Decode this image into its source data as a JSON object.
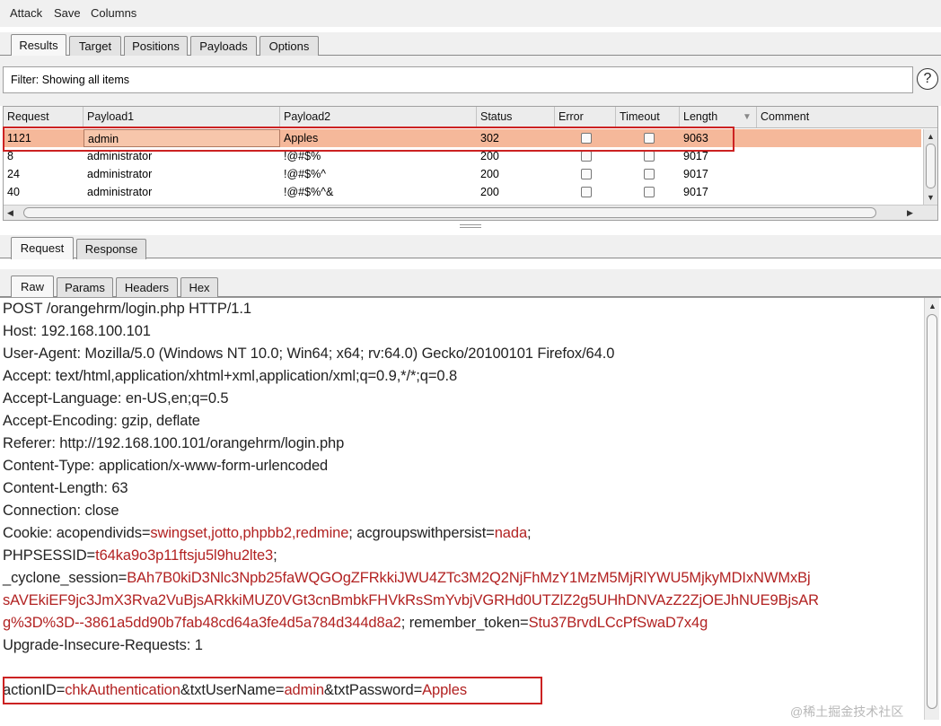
{
  "menu": {
    "attack": "Attack",
    "save": "Save",
    "columns": "Columns"
  },
  "top_tabs": [
    "Results",
    "Target",
    "Positions",
    "Payloads",
    "Options"
  ],
  "filter": {
    "text": "Filter: Showing all items",
    "help": "?"
  },
  "table": {
    "headers": [
      "Request",
      "Payload1",
      "Payload2",
      "Status",
      "Error",
      "Timeout",
      "Length",
      "Comment"
    ],
    "sort_indicator": "▼",
    "rows": [
      {
        "request": "1121",
        "payload1": "admin",
        "payload2": "Apples",
        "status": "302",
        "error": false,
        "timeout": false,
        "length": "9063",
        "comment": ""
      },
      {
        "request": "8",
        "payload1": "administrator",
        "payload2": "!@#$%",
        "status": "200",
        "error": false,
        "timeout": false,
        "length": "9017",
        "comment": ""
      },
      {
        "request": "24",
        "payload1": "administrator",
        "payload2": "!@#$%^",
        "status": "200",
        "error": false,
        "timeout": false,
        "length": "9017",
        "comment": ""
      },
      {
        "request": "40",
        "payload1": "administrator",
        "payload2": "!@#$%^&",
        "status": "200",
        "error": false,
        "timeout": false,
        "length": "9017",
        "comment": ""
      }
    ]
  },
  "reqresp_tabs": [
    "Request",
    "Response"
  ],
  "view_tabs": [
    "Raw",
    "Params",
    "Headers",
    "Hex"
  ],
  "request_lines": {
    "l1": "POST /orangehrm/login.php HTTP/1.1",
    "l2": "Host: 192.168.100.101",
    "l3": "User-Agent: Mozilla/5.0 (Windows NT 10.0; Win64; x64; rv:64.0) Gecko/20100101 Firefox/64.0",
    "l4": "Accept: text/html,application/xhtml+xml,application/xml;q=0.9,*/*;q=0.8",
    "l5": "Accept-Language: en-US,en;q=0.5",
    "l6": "Accept-Encoding: gzip, deflate",
    "l7": "Referer: http://192.168.100.101/orangehrm/login.php",
    "l8": "Content-Type: application/x-www-form-urlencoded",
    "l9": "Content-Length: 63",
    "l10": "Connection: close",
    "cookie_key": "Cookie: acopendivids=",
    "cookie_val1": "swingset,jotto,phpbb2,redmine",
    "cookie_mid": "; acgroupswithpersist=",
    "cookie_val2": "nada",
    "cookie_end": ";",
    "phpsess_key": "PHPSESSID=",
    "phpsess_val": "t64ka9o3p11ftsju5l9hu2lte3",
    "phpsess_end": ";",
    "cyclone_key": "_cyclone_session=",
    "cyclone_val1": "BAh7B0kiD3Nlc3Npb25faWQGOgZFRkkiJWU4ZTc3M2Q2NjFhMzY1MzM5MjRlYWU5MjkyMDIxNWMxBj",
    "cyclone_val2": "sAVEkiEF9jc3JmX3Rva2VuBjsARkkiMUZ0VGt3cnBmbkFHVkRsSmYvbjVGRHd0UTZlZ2g5UHhDNVAzZ2ZjOEJhNUE9BjsAR",
    "cyclone_val3": "g%3D%3D--3861a5dd90b7fab48cd64a3fe4d5a784d344d8a2",
    "remember_key": "; remember_token=",
    "remember_val": "Stu37BrvdLCcPfSwaD7x4g",
    "upgrade": "Upgrade-Insecure-Requests: 1",
    "action_key": "actionID=",
    "action_val": "chkAuthentication",
    "user_key": "&txtUserName=",
    "user_val": "admin",
    "pass_key": "&txtPassword=",
    "pass_val": "Apples"
  },
  "watermark": "@稀土掘金技术社区",
  "colors": {
    "selected_row": "#f5b89a",
    "param_value": "#b22222",
    "highlight_box": "#cc2222"
  }
}
